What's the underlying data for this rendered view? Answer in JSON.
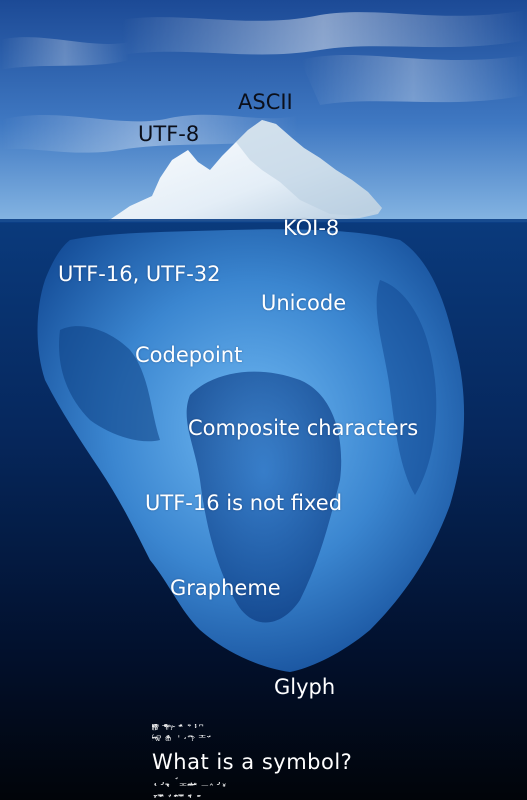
{
  "labels": {
    "ascii": "ASCII",
    "utf8": "UTF-8",
    "koi8": "KOI-8",
    "utf16_utf32": "UTF-16, UTF-32",
    "unicode": "Unicode",
    "codepoint": "Codepoint",
    "composite_characters": "Composite characters",
    "utf16_not_fixed": "UTF-16 is not fixed",
    "grapheme": "Grapheme",
    "glyph": "Glyph",
    "what_is_a_symbol": "What is a symbol?"
  },
  "colors": {
    "sky_top": "#1f4f9c",
    "sky_bottom": "#7fb0e0",
    "water_surface": "#0a3b7e",
    "deep_water": "#01050f",
    "ice_above": "#f4f8fc",
    "ice_below": "#4f9fe0",
    "text_above": "#0b0f1a",
    "text_below": "#ffffff"
  }
}
